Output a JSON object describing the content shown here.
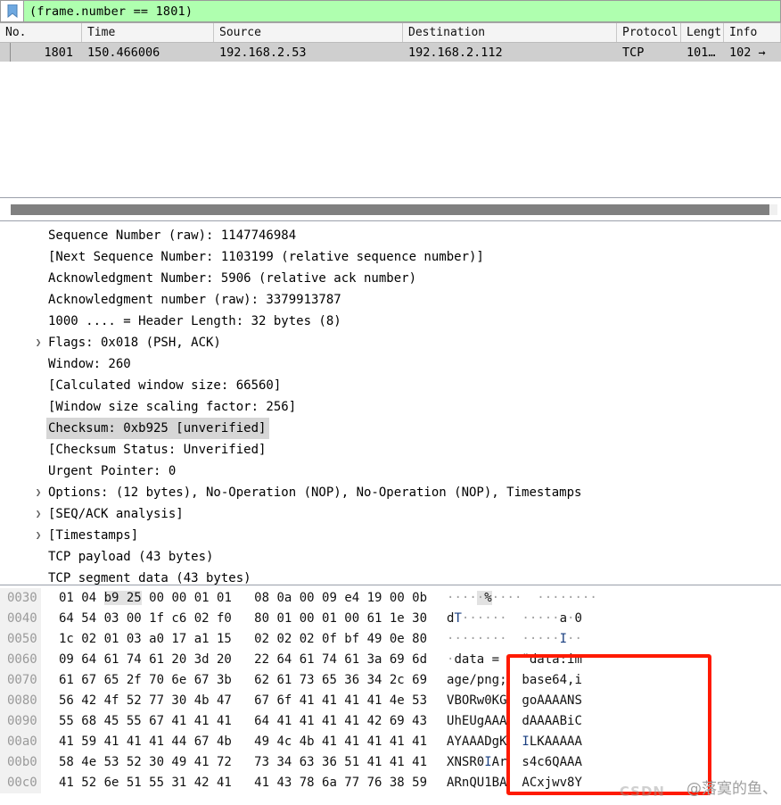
{
  "filter_bar": {
    "bookmark_icon": "bookmark-icon",
    "expression": "(frame.number  == 1801)"
  },
  "packet_list": {
    "columns": [
      "No.",
      "Time",
      "Source",
      "Destination",
      "Protocol",
      "Lengt",
      "Info"
    ],
    "rows": [
      {
        "no": "1801",
        "time": "150.466006",
        "source": "192.168.2.53",
        "destination": "192.168.2.112",
        "protocol": "TCP",
        "length": "101…",
        "info": "102 →"
      }
    ]
  },
  "scrollbar": {
    "orientation": "horizontal",
    "thumb_percent": 99
  },
  "detail_tree": [
    {
      "text": "Sequence Number (raw): 1147746984",
      "expandable": false,
      "selected": false
    },
    {
      "text": "[Next Sequence Number: 1103199    (relative sequence number)]",
      "expandable": false,
      "selected": false
    },
    {
      "text": "Acknowledgment Number: 5906    (relative ack number)",
      "expandable": false,
      "selected": false
    },
    {
      "text": "Acknowledgment number (raw): 3379913787",
      "expandable": false,
      "selected": false
    },
    {
      "text": "1000 .... = Header Length: 32 bytes (8)",
      "expandable": false,
      "selected": false
    },
    {
      "text": "Flags: 0x018 (PSH, ACK)",
      "expandable": true,
      "selected": false
    },
    {
      "text": "Window: 260",
      "expandable": false,
      "selected": false
    },
    {
      "text": "[Calculated window size: 66560]",
      "expandable": false,
      "selected": false
    },
    {
      "text": "[Window size scaling factor: 256]",
      "expandable": false,
      "selected": false
    },
    {
      "text": "Checksum: 0xb925 [unverified]",
      "expandable": false,
      "selected": true
    },
    {
      "text": "[Checksum Status: Unverified]",
      "expandable": false,
      "selected": false
    },
    {
      "text": "Urgent Pointer: 0",
      "expandable": false,
      "selected": false
    },
    {
      "text": "Options: (12 bytes), No-Operation (NOP), No-Operation (NOP), Timestamps",
      "expandable": true,
      "selected": false
    },
    {
      "text": "[SEQ/ACK analysis]",
      "expandable": true,
      "selected": false
    },
    {
      "text": "[Timestamps]",
      "expandable": true,
      "selected": false
    },
    {
      "text": "TCP payload (43 bytes)",
      "expandable": false,
      "selected": false
    },
    {
      "text": "TCP segment data (43 bytes)",
      "expandable": false,
      "selected": false
    }
  ],
  "hex_dump": [
    {
      "offset": "0030",
      "bytes_left": "01 04 ",
      "bytes_hl": "b9 25",
      "bytes_right": " 00 00 01 01",
      "bytes_right2": "08 0a 00 09 e4 19 00 0b",
      "ascii_left": "····",
      "ascii_hl": "·%",
      "ascii_right": "····",
      "ascii_right2": "········"
    },
    {
      "offset": "0040",
      "bytes_left": "64 54 03 00 1f c6 02 f0",
      "bytes_hl": "",
      "bytes_right": "",
      "bytes_right2": "80 01 00 01 00 61 1e 30",
      "ascii_left": "dT······",
      "ascii_hl": "",
      "ascii_right": "",
      "ascii_right2": "·····a·0"
    },
    {
      "offset": "0050",
      "bytes_left": "1c 02 01 03 a0 17 a1 15",
      "bytes_hl": "",
      "bytes_right": "",
      "bytes_right2": "02 02 02 0f bf 49 0e 80",
      "ascii_left": "········",
      "ascii_hl": "",
      "ascii_right": "",
      "ascii_right2": "·····I··"
    },
    {
      "offset": "0060",
      "bytes_left": "09 64 61 74 61 20 3d 20",
      "bytes_hl": "",
      "bytes_right": "",
      "bytes_right2": "22 64 61 74 61 3a 69 6d",
      "ascii_left": "·data = ",
      "ascii_hl": "",
      "ascii_right": "",
      "ascii_right2": "\"data:im"
    },
    {
      "offset": "0070",
      "bytes_left": "61 67 65 2f 70 6e 67 3b",
      "bytes_hl": "",
      "bytes_right": "",
      "bytes_right2": "62 61 73 65 36 34 2c 69",
      "ascii_left": "age/png;",
      "ascii_hl": "",
      "ascii_right": "",
      "ascii_right2": "base64,i"
    },
    {
      "offset": "0080",
      "bytes_left": "56 42 4f 52 77 30 4b 47",
      "bytes_hl": "",
      "bytes_right": "",
      "bytes_right2": "67 6f 41 41 41 41 4e 53",
      "ascii_left": "VBORw0KG",
      "ascii_hl": "",
      "ascii_right": "",
      "ascii_right2": "goAAAANS"
    },
    {
      "offset": "0090",
      "bytes_left": "55 68 45 55 67 41 41 41",
      "bytes_hl": "",
      "bytes_right": "",
      "bytes_right2": "64 41 41 41 41 42 69 43",
      "ascii_left": "UhEUgAAA",
      "ascii_hl": "",
      "ascii_right": "",
      "ascii_right2": "dAAAABiC"
    },
    {
      "offset": "00a0",
      "bytes_left": "41 59 41 41 41 44 67 4b",
      "bytes_hl": "",
      "bytes_right": "",
      "bytes_right2": "49 4c 4b 41 41 41 41 41",
      "ascii_left": "AYAAADgK",
      "ascii_hl": "",
      "ascii_right": "",
      "ascii_right2": "ILKAAAAA"
    },
    {
      "offset": "00b0",
      "bytes_left": "58 4e 53 52 30 49 41 72",
      "bytes_hl": "",
      "bytes_right": "",
      "bytes_right2": "73 34 63 36 51 41 41 41",
      "ascii_left": "XNSR0IAr",
      "ascii_hl": "",
      "ascii_right": "",
      "ascii_right2": "s4c6QAAA"
    },
    {
      "offset": "00c0",
      "bytes_left": "41 52 6e 51 55 31 42 41",
      "bytes_hl": "",
      "bytes_right": "",
      "bytes_right2": "41 43 78 6a 77 76 38 59",
      "ascii_left": "ARnQU1BA",
      "ascii_hl": "",
      "ascii_right": "",
      "ascii_right2": "ACxjwv8Y"
    }
  ],
  "annotation": {
    "shape": "rectangle",
    "color": "#ff1a00"
  },
  "watermarks": {
    "author": "@落寞的鱼、",
    "site": "CSDN"
  }
}
